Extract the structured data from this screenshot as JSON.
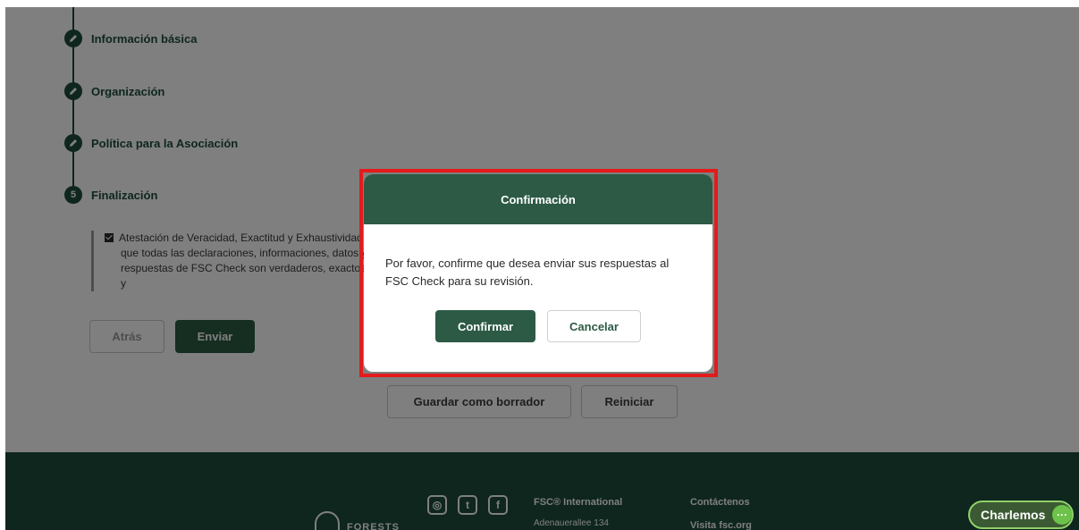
{
  "steps": [
    {
      "label": "Información básica",
      "icon": "pencil-icon"
    },
    {
      "label": "Organización",
      "icon": "pencil-icon"
    },
    {
      "label": "Política para la Asociación",
      "icon": "pencil-icon"
    },
    {
      "label": "Finalización",
      "number": "5"
    }
  ],
  "attestation": {
    "line1": "Atestación de Veracidad, Exactitud y Exhaustividad",
    "line2": "que todas las declaraciones, informaciones, datos y",
    "line3": "respuestas de FSC Check son verdaderos, exactos y",
    "checked": true
  },
  "form_buttons": {
    "back": "Atrás",
    "send": "Enviar",
    "draft": "Guardar como borrador",
    "reset": "Reiniciar"
  },
  "modal": {
    "title": "Confirmación",
    "message": "Por favor, confirme que desea enviar sus respuestas al FSC Check para su revisión.",
    "confirm": "Confirmar",
    "cancel": "Cancelar"
  },
  "footer": {
    "logo_text": "FORESTS",
    "social": [
      "instagram-icon",
      "twitter-icon",
      "facebook-icon"
    ],
    "org_name": "FSC® International",
    "address": "Adenauerallee 134",
    "contact": "Contáctenos",
    "visit": "Visita fsc.org"
  },
  "chat": {
    "label": "Charlemos"
  },
  "colors": {
    "brand": "#2c5a45",
    "highlight": "#e31b1b",
    "chat_accent": "#6cc24a"
  }
}
